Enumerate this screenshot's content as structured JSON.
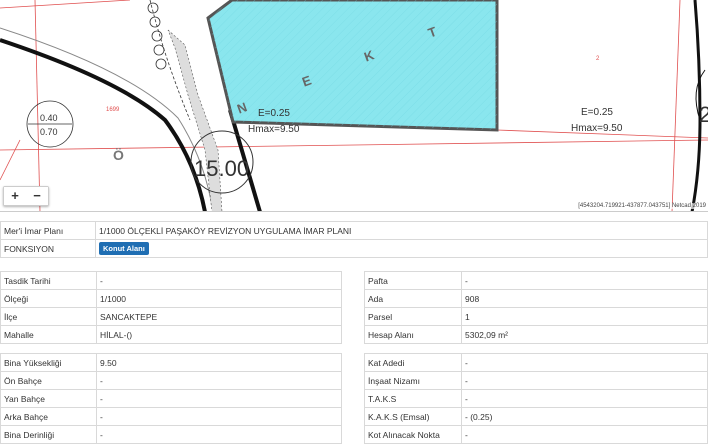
{
  "map": {
    "zoom_in_label": "+",
    "zoom_out_label": "−",
    "coords_text": "[4543204.719921-437877.043751] Netcad 2019",
    "labels": {
      "parcel_left_e": "E=0.25",
      "parcel_left_h": "Hmax=9.50",
      "parcel_right_e": "E=0.25",
      "parcel_right_h": "Hmax=9.50",
      "block_number": "1699",
      "circle_top": "0.40",
      "circle_bottom": "0.70",
      "road_width": "15.00",
      "letter_o": "Ö",
      "letter_n": "N",
      "letter_e": "E",
      "letter_k": "K",
      "letter_t": "T",
      "small_2": "2",
      "edge_2": "2"
    },
    "colors": {
      "parcel_fill": "#8ae6ee",
      "parcel_border": "#555555",
      "boundary_red": "#e05050",
      "road_black": "#111111"
    }
  },
  "info": {
    "plan_label": "Mer'i İmar Planı",
    "plan_value": "1/1000 ÖLÇEKLİ PAŞAKÖY REVİZYON UYGULAMA İMAR PLANI",
    "function_label": "FONKSIYON",
    "function_badge": "Konut Alanı"
  },
  "group1_left": [
    {
      "label": "Tasdik Tarihi",
      "value": "-"
    },
    {
      "label": "Ölçeği",
      "value": "1/1000"
    },
    {
      "label": "İlçe",
      "value": "SANCAKTEPE"
    },
    {
      "label": "Mahalle",
      "value": "HİLAL-()"
    }
  ],
  "group1_right": [
    {
      "label": "Pafta",
      "value": "-"
    },
    {
      "label": "Ada",
      "value": "908"
    },
    {
      "label": "Parsel",
      "value": "1"
    },
    {
      "label": "Hesap Alanı",
      "value": "5302,09 m²"
    }
  ],
  "group2_left": [
    {
      "label": "Bina Yüksekliği",
      "value": "9.50"
    },
    {
      "label": "Ön Bahçe",
      "value": "-"
    },
    {
      "label": "Yan Bahçe",
      "value": "-"
    },
    {
      "label": "Arka Bahçe",
      "value": "-"
    },
    {
      "label": "Bina Derinliği",
      "value": "-"
    }
  ],
  "group2_right": [
    {
      "label": "Kat Adedi",
      "value": "-"
    },
    {
      "label": "İnşaat Nizamı",
      "value": "-"
    },
    {
      "label": "T.A.K.S",
      "value": "-"
    },
    {
      "label": "K.A.K.S (Emsal)",
      "value": "- (0.25)"
    },
    {
      "label": "Kot Alınacak Nokta",
      "value": "-"
    }
  ]
}
